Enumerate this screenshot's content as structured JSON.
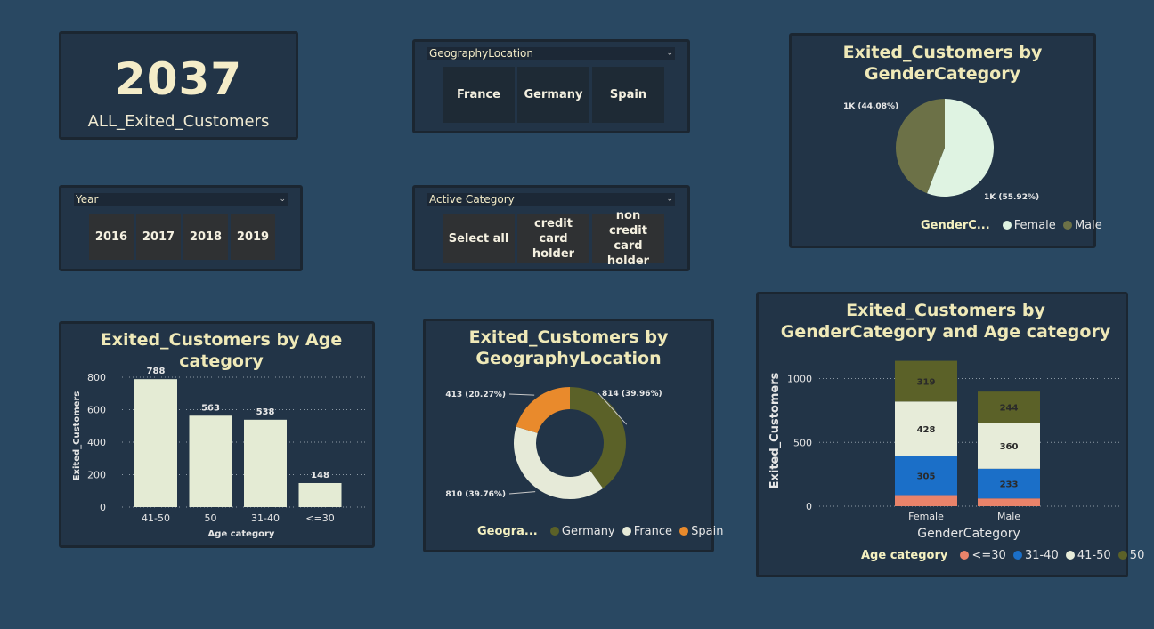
{
  "kpi": {
    "value": "2037",
    "label": "ALL_Exited_Customers"
  },
  "geo_slicer": {
    "title": "GeographyLocation",
    "options": [
      "France",
      "Germany",
      "Spain"
    ]
  },
  "year_slicer": {
    "title": "Year",
    "options": [
      "2016",
      "2017",
      "2018",
      "2019"
    ]
  },
  "active_slicer": {
    "title": "Active Category",
    "options": [
      "Select all",
      "credit card holder",
      "non credit card holder"
    ]
  },
  "colors": {
    "page_bg": "#294862",
    "card_bg": "#223447",
    "title": "#efe9b8",
    "female": "#dff3e2",
    "male": "#6c7147",
    "germany": "#5b6128",
    "france": "#e6ead8",
    "spain": "#e98a2c",
    "age_le30": "#e9836a",
    "age_31_40": "#1b6fc8",
    "age_41_50": "#e7ecd9",
    "age_50": "#5b6128",
    "bar": "#e4ebd4"
  },
  "chart_data": [
    {
      "id": "gender_pie",
      "type": "pie",
      "title": "Exited_Customers by GenderCategory",
      "legend_title": "GenderC...",
      "legend_position": "bottom",
      "slices": [
        {
          "name": "Female",
          "value": 1139,
          "label": "1K (55.92%)"
        },
        {
          "name": "Male",
          "value": 898,
          "label": "1K (44.08%)"
        }
      ]
    },
    {
      "id": "age_bar",
      "type": "bar",
      "title": "Exited_Customers by Age category",
      "xlabel": "Age category",
      "ylabel": "Exited_Customers",
      "categories": [
        "41-50",
        "50",
        "31-40",
        "<=30"
      ],
      "values": [
        788,
        563,
        538,
        148
      ],
      "yticks": [
        0,
        200,
        400,
        600,
        800
      ],
      "ylim": [
        0,
        800
      ],
      "grid": true
    },
    {
      "id": "geo_donut",
      "type": "pie",
      "title": "Exited_Customers by GeographyLocation",
      "legend_title": "Geogra...",
      "legend_position": "bottom",
      "slices": [
        {
          "name": "Germany",
          "value": 814,
          "label": "814 (39.96%)"
        },
        {
          "name": "France",
          "value": 810,
          "label": "810 (39.76%)"
        },
        {
          "name": "Spain",
          "value": 413,
          "label": "413 (20.27%)"
        }
      ]
    },
    {
      "id": "gender_age_stack",
      "type": "bar",
      "stacked": true,
      "title": "Exited_Customers by GenderCategory and Age category",
      "xlabel": "GenderCategory",
      "ylabel": "Exited_Customers",
      "legend_title": "Age category",
      "legend_position": "bottom",
      "categories": [
        "Female",
        "Male"
      ],
      "series": [
        {
          "name": "<=30",
          "values": [
            87,
            61
          ],
          "labels": [
            "",
            ""
          ]
        },
        {
          "name": "31-40",
          "values": [
            305,
            233
          ],
          "labels": [
            "305",
            "233"
          ]
        },
        {
          "name": "41-50",
          "values": [
            428,
            360
          ],
          "labels": [
            "428",
            "360"
          ]
        },
        {
          "name": "50",
          "values": [
            319,
            244
          ],
          "labels": [
            "319",
            "244"
          ]
        }
      ],
      "yticks": [
        0,
        500,
        1000
      ],
      "ylim": [
        0,
        1150
      ],
      "grid": true
    }
  ]
}
